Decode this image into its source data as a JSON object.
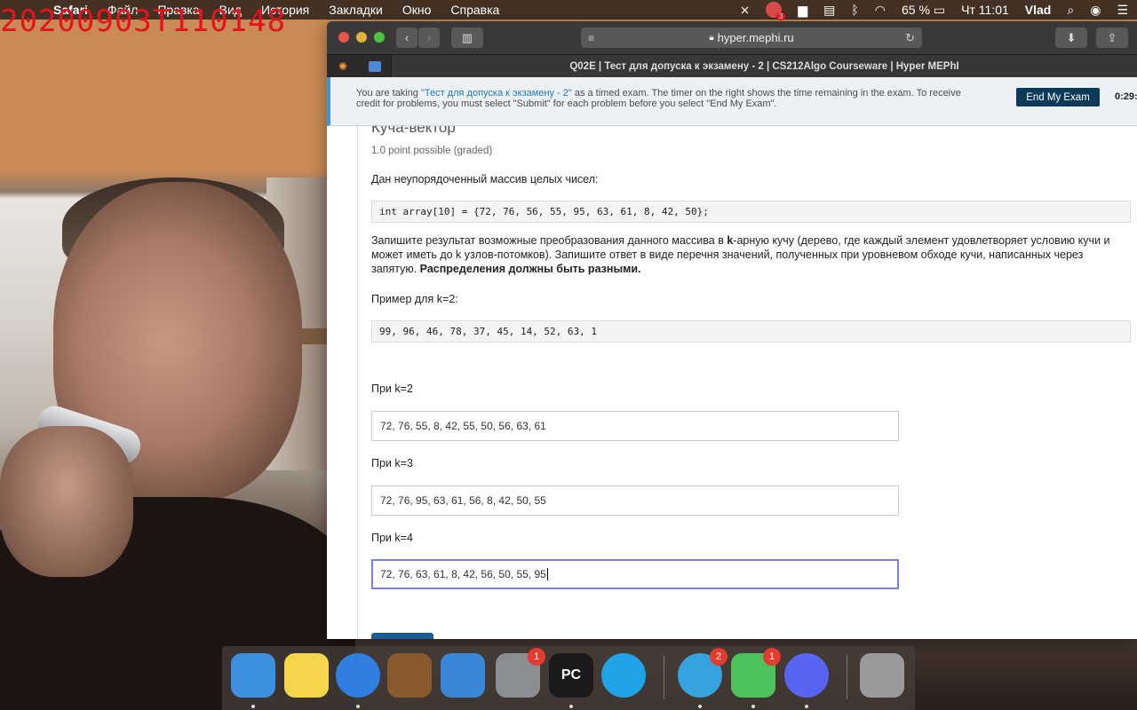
{
  "overlay": {
    "timestamp": "20200903T110148"
  },
  "menubar": {
    "items": [
      "Safari",
      "Файл",
      "Правка",
      "Вид",
      "История",
      "Закладки",
      "Окно",
      "Справка"
    ],
    "battery": "65 %",
    "clock": "Чт 11:01",
    "user": "Vlad",
    "badge": "3"
  },
  "browser": {
    "url": "hyper.mephi.ru",
    "tab_title": "Q02E | Тест для допуска к экзамену - 2 | CS212Algo Courseware | Hyper MEPhI"
  },
  "exam_banner": {
    "text_before": "You are taking ",
    "exam_link": "\"Тест для допуска к экзамену - 2\"",
    "text_after": " as a timed exam. The timer on the right shows the time remaining in the exam. To receive credit for problems, you must select \"Submit\" for each problem before you select \"End My Exam\".",
    "end_button": "End My Exam",
    "timer": "0:29:"
  },
  "problem": {
    "title": "Куча-вектор",
    "points": "1.0 point possible (graded)",
    "intro": "Дан неупорядоченный массив целых чисел:",
    "array_code": "int array[10] = {72, 76, 56, 55, 95, 63, 61, 8, 42, 50};",
    "task_before": "Запишите результат возможные преобразования данного массива в ",
    "task_k": "k",
    "task_middle": "-арную кучу (дерево, где каждый элемент удовлетворяет условию кучи и может иметь до k узлов-потомков). Запишите ответ в виде перечня значений, полученных при уровневом обходе кучи, написанных через запятую. ",
    "task_bold": "Распределения должны быть разными.",
    "example_label": "Пример для k=2:",
    "example_code": "99, 96, 46, 78, 37, 45, 14, 52, 63, 1",
    "answers": [
      {
        "label": "При k=2",
        "value": "72, 76, 55, 8, 42, 55, 50, 56, 63, 61"
      },
      {
        "label": "При k=3",
        "value": "72, 76, 95, 63, 61, 56, 8, 42, 50, 55"
      },
      {
        "label": "При k=4",
        "value": "72, 76, 63, 61, 8, 42, 56, 50, 55, 95"
      }
    ]
  },
  "dock": {
    "apps": [
      {
        "name": "Finder",
        "icon": "finder-icon",
        "color": "#3d8fe0",
        "running": true
      },
      {
        "name": "Notes",
        "icon": "notes-icon",
        "color": "#f5d64a",
        "running": false
      },
      {
        "name": "Safari",
        "icon": "safari-icon",
        "color": "#2f7ee0",
        "running": true
      },
      {
        "name": "GarageBand",
        "icon": "guitar-icon",
        "color": "#8a5a2e",
        "running": false
      },
      {
        "name": "Xcode",
        "icon": "xcode-icon",
        "color": "#3a86d8",
        "running": false
      },
      {
        "name": "System Preferences",
        "icon": "gear-icon",
        "color": "#8a8d92",
        "running": false,
        "badge": "1"
      },
      {
        "name": "PyCharm",
        "glyph": "PC",
        "icon": "pycharm-icon",
        "color": "#1a1a1a",
        "running": true
      },
      {
        "name": "Skype",
        "icon": "skype-icon",
        "color": "#1fa3e6",
        "running": false
      },
      {
        "name": "Telegram",
        "icon": "telegram-icon",
        "color": "#35a3de",
        "running": true,
        "badge": "2"
      },
      {
        "name": "FaceTime",
        "icon": "facetime-icon",
        "color": "#4cc35a",
        "running": true,
        "badge": "1"
      },
      {
        "name": "Discord",
        "icon": "discord-icon",
        "color": "#5865f2",
        "running": true
      },
      {
        "name": "Trash",
        "icon": "trash-icon",
        "color": "#9a9a9a",
        "running": false
      }
    ]
  }
}
